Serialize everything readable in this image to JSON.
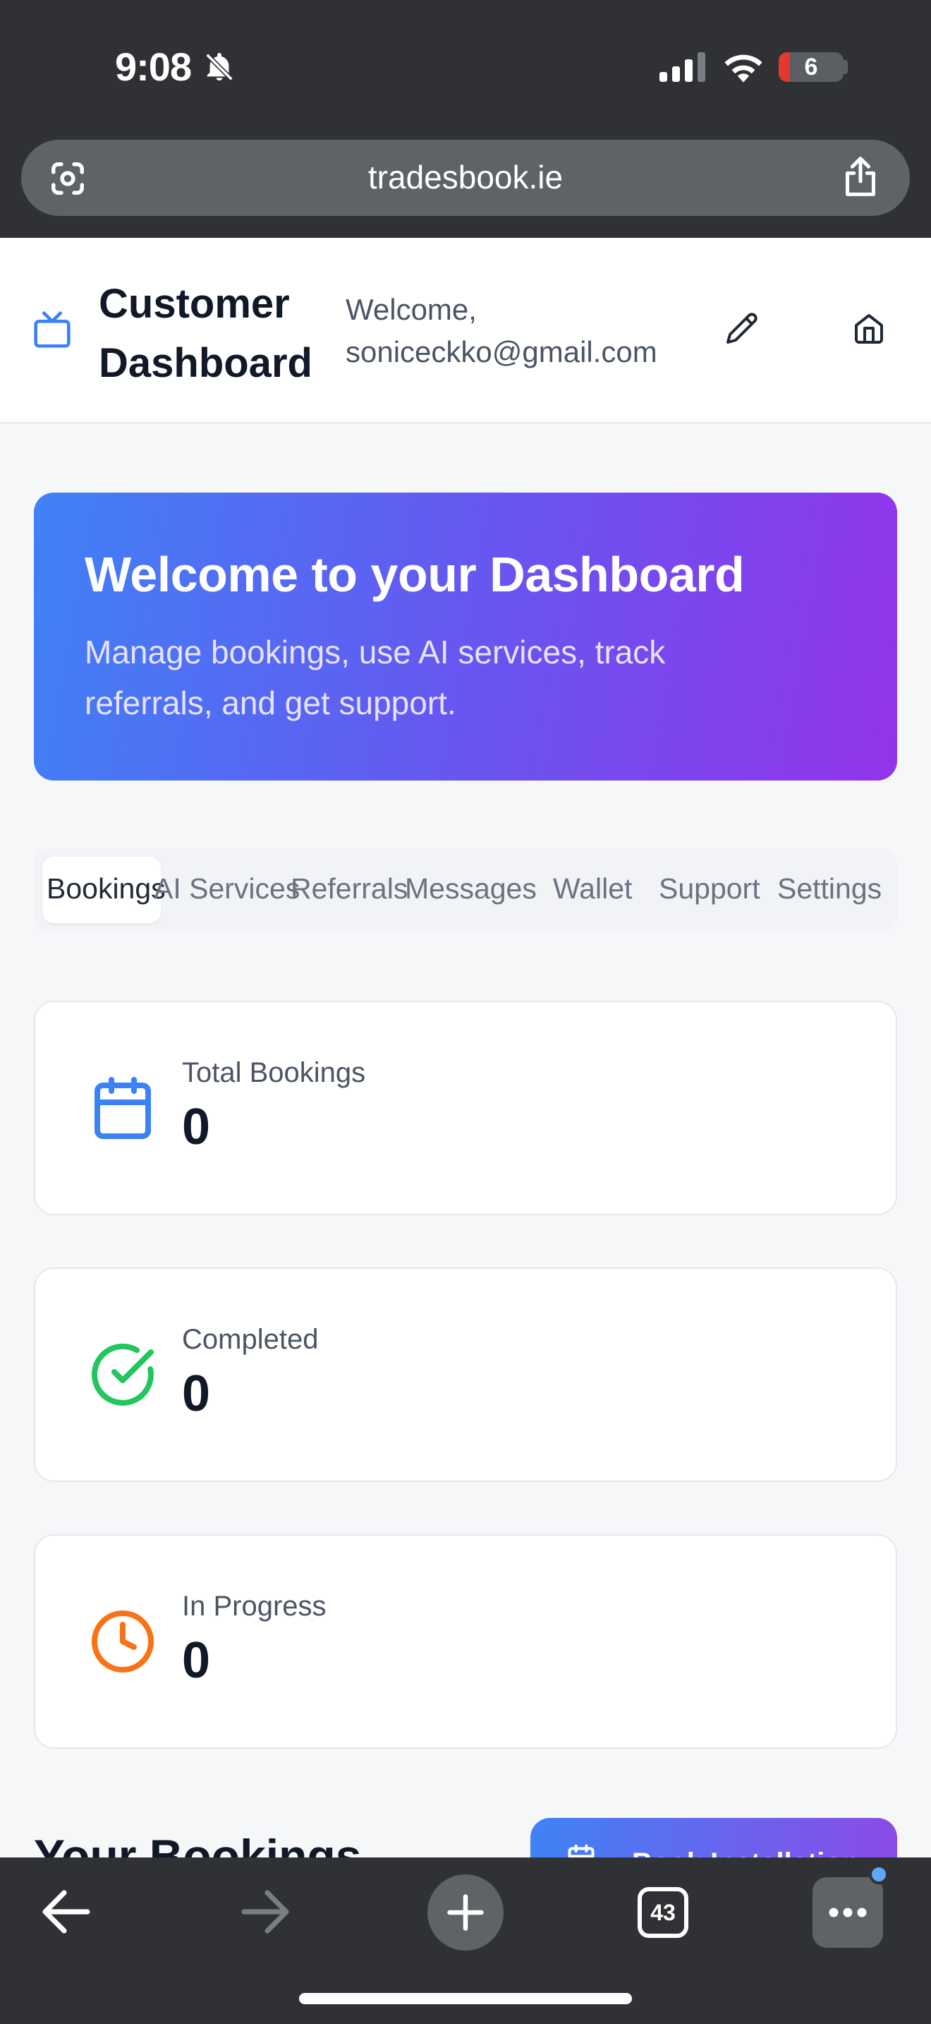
{
  "status_bar": {
    "time": "9:08",
    "battery": "6",
    "icons": [
      "bell-slash-icon",
      "cellular-signal-icon",
      "wifi-icon",
      "battery-icon"
    ]
  },
  "browser": {
    "url": "tradesbook.ie",
    "tab_count": "43",
    "icons": [
      "lens-icon",
      "share-icon",
      "back-arrow-icon",
      "forward-arrow-icon",
      "plus-icon",
      "tabs-icon",
      "more-icon"
    ]
  },
  "header": {
    "title": "Customer Dashboard",
    "welcome": "Welcome,",
    "email": "soniceckko@gmail.com",
    "icons": [
      "tv-icon",
      "pencil-icon",
      "home-icon"
    ]
  },
  "hero": {
    "title": "Welcome to your Dashboard",
    "subtitle": "Manage bookings, use AI services, track referrals, and get support."
  },
  "tabs": [
    {
      "label": "Bookings",
      "active": true
    },
    {
      "label": "AI Services",
      "active": false
    },
    {
      "label": "Referrals",
      "active": false
    },
    {
      "label": "Messages",
      "active": false
    },
    {
      "label": "Wallet",
      "active": false
    },
    {
      "label": "Support",
      "active": false
    },
    {
      "label": "Settings",
      "active": false
    }
  ],
  "stats": [
    {
      "label": "Total Bookings",
      "value": "0",
      "icon": "calendar-icon",
      "color": "#3b82f6"
    },
    {
      "label": "Completed",
      "value": "0",
      "icon": "check-circle-icon",
      "color": "#22c55e"
    },
    {
      "label": "In Progress",
      "value": "0",
      "icon": "clock-icon",
      "color": "#f97316"
    }
  ],
  "bookings": {
    "title": "Your Bookings",
    "book_button": "Book Installation"
  },
  "colors": {
    "hero_gradient_start": "#3f82f6",
    "hero_gradient_end": "#9334ea",
    "browser_chrome": "#2f3134"
  }
}
